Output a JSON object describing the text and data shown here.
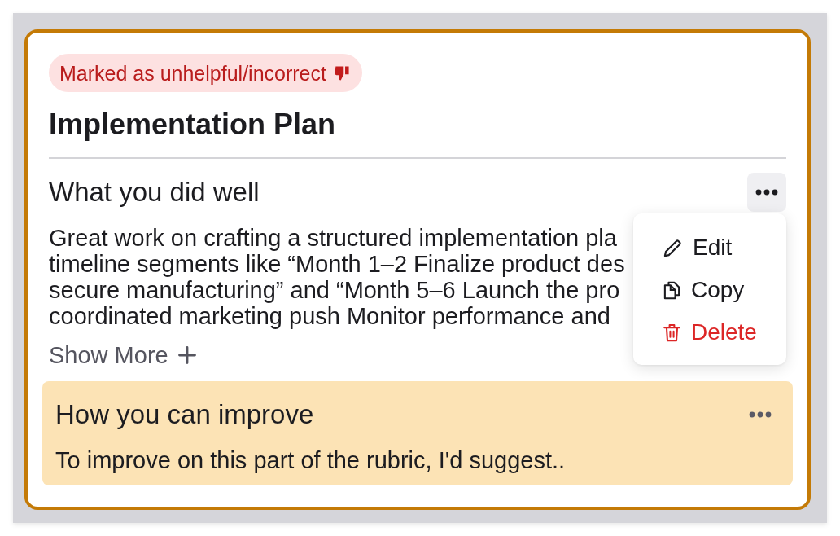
{
  "feedback_card": {
    "badge": {
      "label": "Marked as unhelpful/incorrect"
    },
    "title": "Implementation Plan",
    "sections": [
      {
        "kind": "strength",
        "heading": "What you did well",
        "more_button": {
          "expanded": true
        },
        "body_lines": [
          "Great work on crafting a structured implementation pla",
          "timeline segments like “Month 1–2 Finalize product des",
          "secure manufacturing” and “Month 5–6 Launch the pro",
          "coordinated marketing push Monitor performance and"
        ],
        "show_more": "Show More",
        "menu": {
          "items": [
            {
              "kind": "edit",
              "label": "Edit"
            },
            {
              "kind": "copy",
              "label": "Copy"
            },
            {
              "kind": "delete",
              "label": "Delete"
            }
          ]
        }
      },
      {
        "kind": "improvement",
        "heading": "How you can improve",
        "more_button": {
          "expanded": false
        },
        "body_lines": [
          "To improve on this part of the rubric, I'd suggest.."
        ]
      }
    ]
  }
}
